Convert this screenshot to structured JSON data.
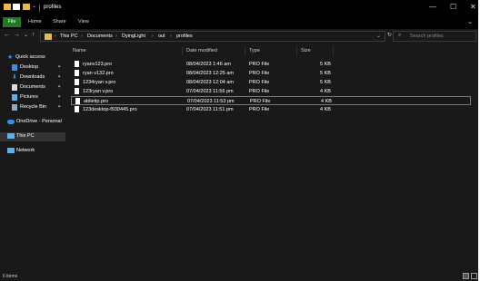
{
  "titlebar": {
    "title": "profiles",
    "minimize": "—",
    "maximize": "☐",
    "close": "✕"
  },
  "ribbon": {
    "file": "File",
    "home": "Home",
    "share": "Share",
    "view": "View",
    "help_chevron": "⌄"
  },
  "address": {
    "back": "←",
    "forward": "→",
    "recent": "⌄",
    "up": "↑",
    "crumbs": [
      "This PC",
      "Documents",
      "DyingLight",
      "out",
      "profiles"
    ],
    "separator": "›",
    "dropdown": "⌄",
    "refresh": "↻"
  },
  "search": {
    "placeholder": "Search profiles",
    "icon": "⌕"
  },
  "sidebar": {
    "items": [
      {
        "label": "Quick access",
        "icon": "star-icon"
      },
      {
        "label": "Desktop",
        "icon": "desktop-icon"
      },
      {
        "label": "Downloads",
        "icon": "download-icon"
      },
      {
        "label": "Documents",
        "icon": "documents-icon"
      },
      {
        "label": "Pictures",
        "icon": "pictures-icon"
      },
      {
        "label": "Recycle Bin",
        "icon": "recycle-bin-icon"
      },
      {
        "label": "OneDrive - Personal",
        "icon": "cloud-icon"
      },
      {
        "label": "This PC",
        "icon": "computer-icon"
      },
      {
        "label": "Network",
        "icon": "network-icon"
      }
    ],
    "pin": "📌"
  },
  "columns": {
    "name": "Name",
    "date": "Date modified",
    "type": "Type",
    "size": "Size"
  },
  "files": [
    {
      "name": "ryanv123.pro",
      "date": "08/04/2023 1:46 am",
      "type": "PRO File",
      "size": "5 KB"
    },
    {
      "name": "ryan v132.pro",
      "date": "08/04/2023 12:25 am",
      "type": "PRO File",
      "size": "5 KB"
    },
    {
      "name": "1234ryan v.pro",
      "date": "08/04/2023 12:04 am",
      "type": "PRO File",
      "size": "5 KB"
    },
    {
      "name": "123ryan v.pro",
      "date": "07/04/2023 11:56 pm",
      "type": "PRO File",
      "size": "4 KB"
    },
    {
      "name": "ablietip.pro",
      "date": "07/04/2023 11:53 pm",
      "type": "PRO File",
      "size": "4 KB"
    },
    {
      "name": "123desktop-f930445.pro",
      "date": "07/04/2023 11:51 pm",
      "type": "PRO File",
      "size": "4 KB"
    }
  ],
  "status": {
    "text": "6 items"
  },
  "colors": {
    "file_tab": "#1f7a22",
    "folder": "#e8b84a",
    "accent": "#3a8ee6"
  }
}
